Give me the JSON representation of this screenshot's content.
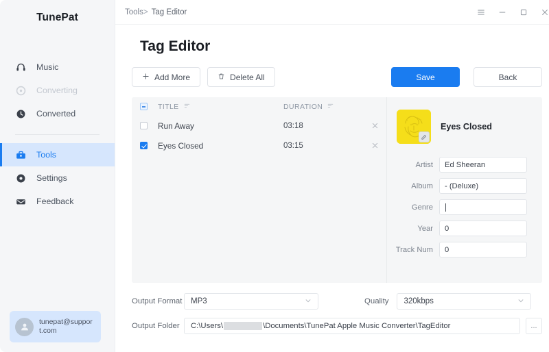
{
  "sidebar": {
    "brand": "TunePat",
    "items": [
      {
        "label": "Music",
        "icon": "headphones-icon",
        "state": "normal"
      },
      {
        "label": "Converting",
        "icon": "converting-icon",
        "state": "disabled"
      },
      {
        "label": "Converted",
        "icon": "clock-icon",
        "state": "normal"
      },
      {
        "label": "Tools",
        "icon": "toolbox-icon",
        "state": "active"
      },
      {
        "label": "Settings",
        "icon": "gear-icon",
        "state": "normal"
      },
      {
        "label": "Feedback",
        "icon": "envelope-icon",
        "state": "normal"
      }
    ],
    "account": {
      "email": "tunepat@support.com",
      "icon": "user-avatar-icon"
    }
  },
  "titlebar": {
    "breadcrumb_root": "Tools",
    "breadcrumb_sep": ">",
    "breadcrumb_leaf": "Tag Editor",
    "menu_icon": "hamburger-menu-icon",
    "minimize_icon": "minimize-icon",
    "maximize_icon": "maximize-icon",
    "close_icon": "close-icon"
  },
  "page": {
    "title": "Tag Editor"
  },
  "toolbar": {
    "add_more": "Add More",
    "add_more_icon": "plus-icon",
    "delete_all": "Delete All",
    "delete_all_icon": "trash-icon",
    "save": "Save",
    "back": "Back",
    "accent_color": "#1a7cf0"
  },
  "table": {
    "headers": {
      "title": "TITLE",
      "duration": "DURATION"
    },
    "header_checkbox_state": "indeterminate",
    "sort_icon": "sort-icon",
    "remove_icon": "remove-row-icon",
    "rows": [
      {
        "checked": false,
        "title": "Run Away",
        "duration": "03:18"
      },
      {
        "checked": true,
        "title": "Eyes Closed",
        "duration": "03:15"
      }
    ]
  },
  "meta": {
    "cover_icon": "album-cover-thumbnail",
    "cover_edit_icon": "edit-cover-icon",
    "cover_color": "#f5de1a",
    "track_title": "Eyes Closed",
    "fields": [
      {
        "label": "Artist",
        "value": "Ed Sheeran",
        "focused": false
      },
      {
        "label": "Album",
        "value": "- (Deluxe)",
        "focused": false
      },
      {
        "label": "Genre",
        "value": "",
        "focused": true
      },
      {
        "label": "Year",
        "value": "0",
        "focused": false
      },
      {
        "label": "Track Num",
        "value": "0",
        "focused": false
      }
    ]
  },
  "bottom": {
    "output_format_label": "Output Format",
    "output_format_value": "MP3",
    "quality_label": "Quality",
    "quality_value": "320kbps",
    "output_folder_label": "Output Folder",
    "output_folder_prefix": "C:\\Users\\",
    "output_folder_suffix": "\\Documents\\TunePat Apple Music Converter\\TagEditor",
    "chevron_icon": "chevron-down-icon",
    "browse_icon": "ellipsis-icon",
    "browse_label": "..."
  }
}
